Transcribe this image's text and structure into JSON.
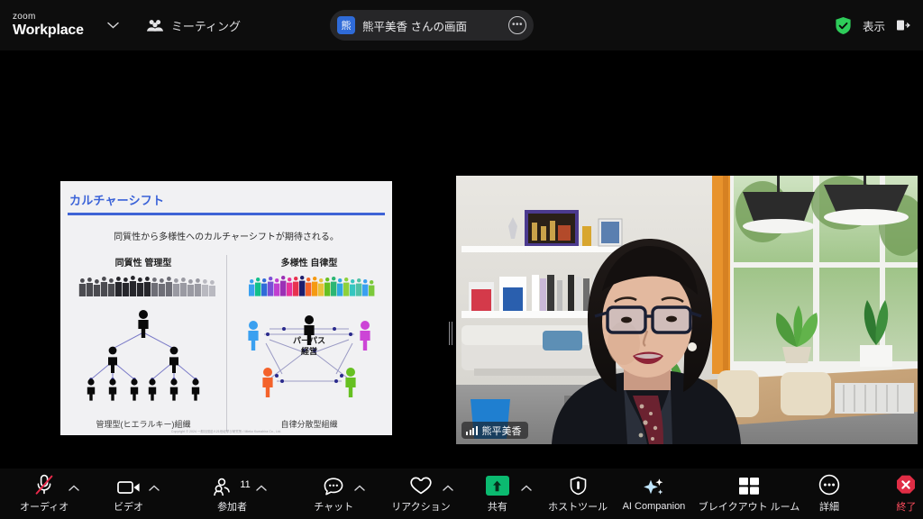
{
  "header": {
    "brand_small": "zoom",
    "brand_main": "Workplace",
    "brand_chevron_icon": "chevron-down-icon",
    "meeting_icon": "people-group-icon",
    "meeting_label": "ミーティング",
    "share_pill": {
      "avatar_initial": "熊",
      "title": "熊平美香 さんの画面",
      "more_icon": "more-options-icon"
    },
    "security_icon": "shield-check-icon",
    "security_color": "#2ecc5a",
    "view_label": "表示",
    "exit_fullscreen_icon": "exit-fullscreen-icon"
  },
  "stage": {
    "annotate_icon": "pencil-annotate-icon",
    "annotate_color": "#16b364",
    "splitter_name": "panel-splitter"
  },
  "slide": {
    "title": "カルチャーシフト",
    "subtitle": "同質性から多様性へのカルチャーシフトが期待される。",
    "left_heading": "同質性  管理型",
    "right_heading": "多様性  自律型",
    "left_caption": "管理型(ヒエラルキー)組織",
    "right_caption": "自律分散型組織",
    "center_text_line1": "パーパス",
    "center_text_line2": "経営",
    "copyright": "Copyright © 2024 一般社団法人21世紀学び研究所 / Mieko Kumahira Co., Ltd.",
    "accent_color": "#3f63d6",
    "figure_colors": [
      "#3aa0f0",
      "#cc45d6",
      "#f4622a",
      "#66c021",
      "#111111"
    ]
  },
  "video": {
    "participant_name": "熊平美香",
    "signal_icon": "signal-bars-icon"
  },
  "footer": {
    "items": [
      {
        "name": "audio",
        "icon": "microphone-muted-icon",
        "label": "オーディオ",
        "caret": true,
        "count": ""
      },
      {
        "name": "video",
        "icon": "camera-icon",
        "label": "ビデオ",
        "caret": true,
        "count": ""
      },
      {
        "name": "participants",
        "icon": "participants-icon",
        "label": "参加者",
        "caret": true,
        "count": "11"
      },
      {
        "name": "chat",
        "icon": "chat-bubble-icon",
        "label": "チャット",
        "caret": true,
        "count": ""
      },
      {
        "name": "reactions",
        "icon": "heart-icon",
        "label": "リアクション",
        "caret": true,
        "count": ""
      },
      {
        "name": "share",
        "icon": "share-screen-icon",
        "label": "共有",
        "caret": true,
        "count": ""
      },
      {
        "name": "host-tools",
        "icon": "shield-icon",
        "label": "ホストツール",
        "caret": false,
        "count": ""
      },
      {
        "name": "ai-companion",
        "icon": "sparkles-icon",
        "label": "AI Companion",
        "caret": false,
        "count": ""
      },
      {
        "name": "breakout-rooms",
        "icon": "grid-squares-icon",
        "label": "ブレイクアウト ルーム",
        "caret": false,
        "count": ""
      },
      {
        "name": "more",
        "icon": "more-circle-icon",
        "label": "詳細",
        "caret": false,
        "count": ""
      },
      {
        "name": "end",
        "icon": "end-call-icon",
        "label": "終了",
        "caret": false,
        "count": ""
      }
    ],
    "share_button_color": "#0bba70",
    "end_button_color": "#e02d45"
  }
}
